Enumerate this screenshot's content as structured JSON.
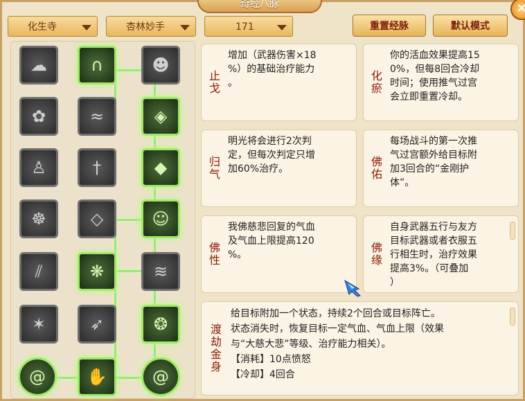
{
  "window": {
    "title": "奇经八脉",
    "close_label": "×"
  },
  "toolbar": {
    "dropdown1": "化生寺",
    "dropdown2": "杏林妙手",
    "dropdown3": "171",
    "reset_label": "重置经脉",
    "default_label": "默认模式"
  },
  "tree": {
    "icon_names": [
      [
        "cloud-icon",
        "arch-icon",
        "face-icon"
      ],
      [
        "lotus-icon",
        "wave-icon",
        "gem-icon"
      ],
      [
        "buddha-icon",
        "sword-icon",
        "crystal-icon"
      ],
      [
        "meditate-icon",
        "jewel-icon",
        "mask-icon"
      ],
      [
        "needles-icon",
        "knot-icon",
        "curtain-icon"
      ],
      [
        "shards-icon",
        "bird-icon",
        "lion-icon"
      ],
      [
        "swirl-icon",
        "hand-icon",
        "swirl-icon"
      ]
    ]
  },
  "cards": {
    "c1": {
      "name": "止戈",
      "desc": "增加（武器伤害×18\n%）的基础治疗能力\n。"
    },
    "c2": {
      "name": "化瘀",
      "desc": "你的活血效果提高15\n0%，但每8回合冷却\n时间；使用推气过宫\n会立即重置冷却。"
    },
    "c3": {
      "name": "归气",
      "desc": "明光将会进行2次判\n定，但每次判定只增\n加60%治疗。"
    },
    "c4": {
      "name": "佛佑",
      "desc": "每场战斗的第一次推\n气过宫额外给目标附\n加3回合的“金刚护\n体”。"
    },
    "c5": {
      "name": "佛性",
      "desc": "我佛慈悲回复的气血\n及气血上限提高120\n%。"
    },
    "c6": {
      "name": "佛缘",
      "desc": "自身武器五行与友方\n目标武器或者衣服五\n行相生时，治疗效果\n提高3%。（可叠加\n）"
    },
    "c7": {
      "name": "渡劫金身",
      "desc": "给目标附加一个状态，持续2个回合或目标阵亡。\n状态消失时，恢复目标一定气血、气血上限（效果\n与“大慈大悲”等级、治疗能力相关）。\n【消耗】10点愤怒\n【冷却】4回合"
    }
  }
}
